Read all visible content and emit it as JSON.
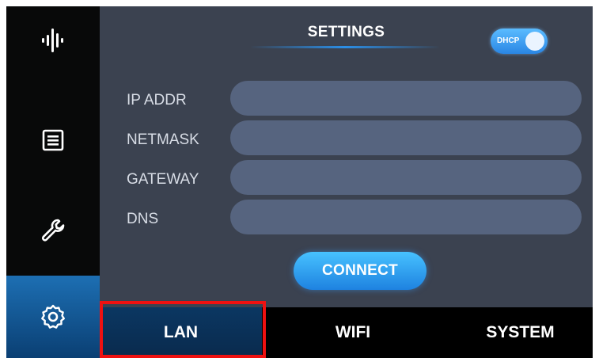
{
  "screen": {
    "title": "SETTINGS",
    "dhcp_label": "DHCP",
    "dhcp_enabled": true
  },
  "sidebar": {
    "items": [
      {
        "icon": "audio-levels-icon",
        "active": false
      },
      {
        "icon": "list-document-icon",
        "active": false
      },
      {
        "icon": "wrench-icon",
        "active": false
      },
      {
        "icon": "gear-icon",
        "active": true
      }
    ]
  },
  "fields": [
    {
      "label": "IP ADDR",
      "value": "",
      "placeholder": ""
    },
    {
      "label": "NETMASK",
      "value": "",
      "placeholder": ""
    },
    {
      "label": "GATEWAY",
      "value": "",
      "placeholder": ""
    },
    {
      "label": "DNS",
      "value": "",
      "placeholder": ""
    }
  ],
  "connect_label": "CONNECT",
  "tabs": [
    {
      "label": "LAN",
      "active": true
    },
    {
      "label": "WIFI",
      "active": false
    },
    {
      "label": "SYSTEM",
      "active": false
    }
  ],
  "colors": {
    "panel_bg": "#3b4250",
    "input_bg": "#56647f",
    "accent": "#2a86e4",
    "highlight": "#ef1111"
  }
}
